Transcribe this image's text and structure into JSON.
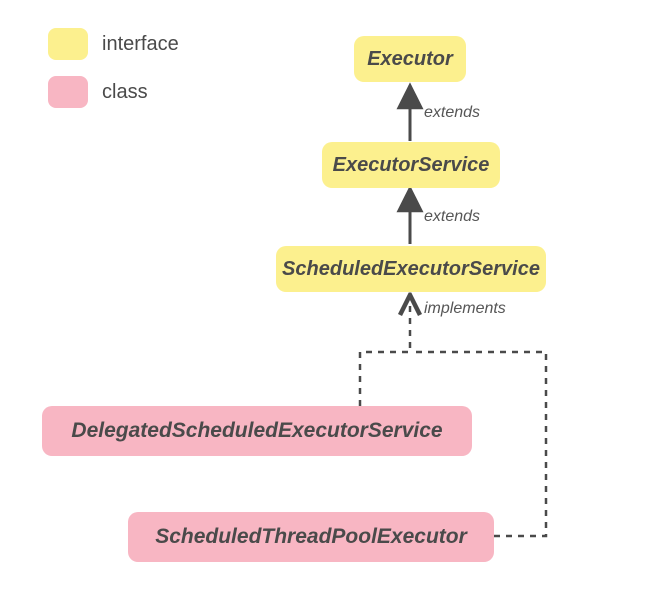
{
  "legend": {
    "interface_label": "interface",
    "class_label": "class"
  },
  "nodes": {
    "executor": "Executor",
    "executor_service": "ExecutorService",
    "scheduled_executor_service": "ScheduledExecutorService",
    "delegated_scheduled_executor_service": "DelegatedScheduledExecutorService",
    "scheduled_thread_pool_executor": "ScheduledThreadPoolExecutor"
  },
  "edges": {
    "extends1": "extends",
    "extends2": "extends",
    "implements": "implements"
  },
  "colors": {
    "interface": "#fcf08e",
    "class": "#f8b6c3",
    "text": "#4a4a4a",
    "connector": "#4a4a4a"
  }
}
